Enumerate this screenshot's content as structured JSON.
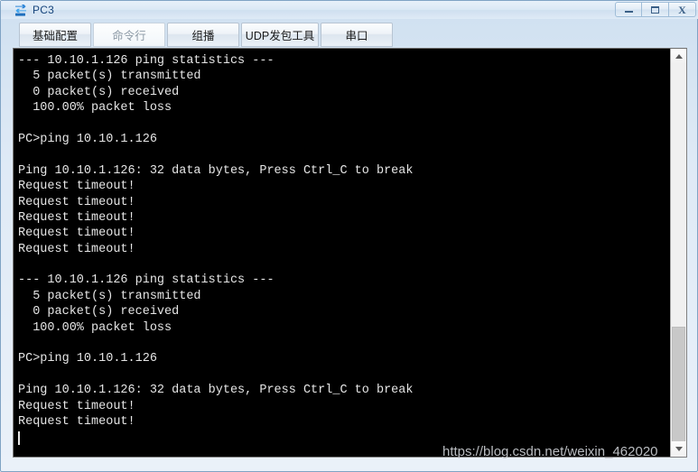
{
  "window": {
    "title": "PC3",
    "icon": "pc-network-icon",
    "controls": [
      {
        "name": "minimize-button",
        "label": "–",
        "icon": "minimize-icon"
      },
      {
        "name": "maximize-button",
        "label": "□",
        "icon": "maximize-icon"
      },
      {
        "name": "close-button",
        "label": "X",
        "icon": "close-icon"
      }
    ]
  },
  "tabs": [
    {
      "label": "基础配置",
      "active": false
    },
    {
      "label": "命令行",
      "active": true
    },
    {
      "label": "组播",
      "active": false
    },
    {
      "label": "UDP发包工具",
      "active": false
    },
    {
      "label": "串口",
      "active": false
    }
  ],
  "terminal": {
    "lines": [
      "--- 10.10.1.126 ping statistics ---",
      "  5 packet(s) transmitted",
      "  0 packet(s) received",
      "  100.00% packet loss",
      "",
      "PC>ping 10.10.1.126",
      "",
      "Ping 10.10.1.126: 32 data bytes, Press Ctrl_C to break",
      "Request timeout!",
      "Request timeout!",
      "Request timeout!",
      "Request timeout!",
      "Request timeout!",
      "",
      "--- 10.10.1.126 ping statistics ---",
      "  5 packet(s) transmitted",
      "  0 packet(s) received",
      "  100.00% packet loss",
      "",
      "PC>ping 10.10.1.126",
      "",
      "Ping 10.10.1.126: 32 data bytes, Press Ctrl_C to break",
      "Request timeout!",
      "Request timeout!"
    ],
    "cursor_visible": true,
    "background_color": "#000000",
    "text_color": "#e6e6e6"
  },
  "scrollbar": {
    "up_arrow": "chevron-up-icon",
    "down_arrow": "chevron-down-icon",
    "thumb_position_percent": 70
  },
  "watermark": {
    "text": "https://blog.csdn.net/weixin_462020"
  }
}
